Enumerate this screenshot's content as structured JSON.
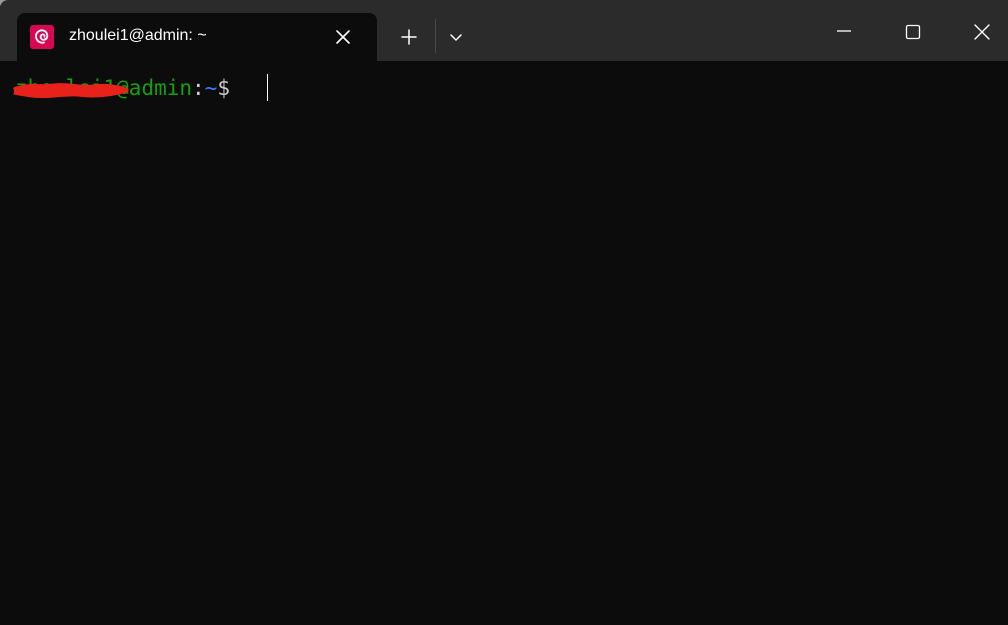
{
  "window": {
    "tab_title": "zhoulei1@admin: ~",
    "tab_icon": "debian-logo-icon",
    "accent": "#d70751",
    "buttons": [
      "new-tab-plus-icon",
      "dropdown-chevron-icon",
      "minimize-icon",
      "maximize-icon",
      "close-icon"
    ]
  },
  "terminal": {
    "prompt_user": "zhoulei1",
    "prompt_host": "@admin",
    "prompt_colon": ":",
    "prompt_path": "~",
    "prompt_symbol": "$",
    "colors": {
      "background": "#0c0c0c",
      "user_host": "#13a10e",
      "path": "#3b78ff",
      "text": "#cccccc",
      "redaction": "#e8221b"
    }
  }
}
